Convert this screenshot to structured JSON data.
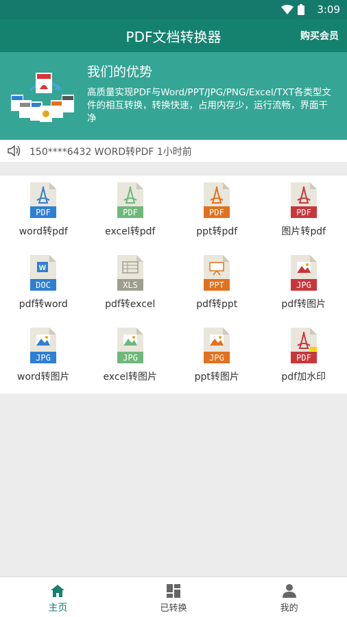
{
  "status_bar": {
    "time": "3:09"
  },
  "header": {
    "title": "PDF文档转换器",
    "vip_button": "购买会员"
  },
  "banner": {
    "headline": "我们的优势",
    "description": "高质量实现PDF与Word/PPT/JPG/PNG/Excel/TXT各类型文件的相互转换，转换快速，占用内存少，运行流畅，界面干净"
  },
  "ticker": {
    "message": "150****6432  WORD转PDF  1小时前"
  },
  "tools": [
    {
      "label": "word转pdf",
      "badge": "PDF",
      "badge_color": "#2f7fd4",
      "glyph": "pdf"
    },
    {
      "label": "excel转pdf",
      "badge": "PDF",
      "badge_color": "#6fb87a",
      "glyph": "pdf"
    },
    {
      "label": "ppt转pdf",
      "badge": "PDF",
      "badge_color": "#e2711d",
      "glyph": "pdf"
    },
    {
      "label": "图片转pdf",
      "badge": "PDF",
      "badge_color": "#c9363a",
      "glyph": "pdf"
    },
    {
      "label": "pdf转word",
      "badge": "DOC",
      "badge_color": "#2f7fd4",
      "glyph": "word"
    },
    {
      "label": "pdf转excel",
      "badge": "XLS",
      "badge_color": "#9e9e8e",
      "glyph": "sheet"
    },
    {
      "label": "pdf转ppt",
      "badge": "PPT",
      "badge_color": "#e2711d",
      "glyph": "slide"
    },
    {
      "label": "pdf转图片",
      "badge": "JPG",
      "badge_color": "#c9363a",
      "glyph": "image"
    },
    {
      "label": "word转图片",
      "badge": "JPG",
      "badge_color": "#2f7fd4",
      "glyph": "image"
    },
    {
      "label": "excel转图片",
      "badge": "JPG",
      "badge_color": "#6fb87a",
      "glyph": "image"
    },
    {
      "label": "ppt转图片",
      "badge": "JPG",
      "badge_color": "#e2711d",
      "glyph": "image"
    },
    {
      "label": "pdf加水印",
      "badge": "PDF",
      "badge_color": "#c9363a",
      "glyph": "pdf"
    }
  ],
  "tabs": [
    {
      "label": "主页",
      "icon": "home-icon",
      "active": true
    },
    {
      "label": "已转换",
      "icon": "grid-icon",
      "active": false
    },
    {
      "label": "我的",
      "icon": "person-icon",
      "active": false
    }
  ],
  "colors": {
    "primary": "#14826f",
    "banner": "#35a595",
    "status_bar": "#137a6c"
  }
}
